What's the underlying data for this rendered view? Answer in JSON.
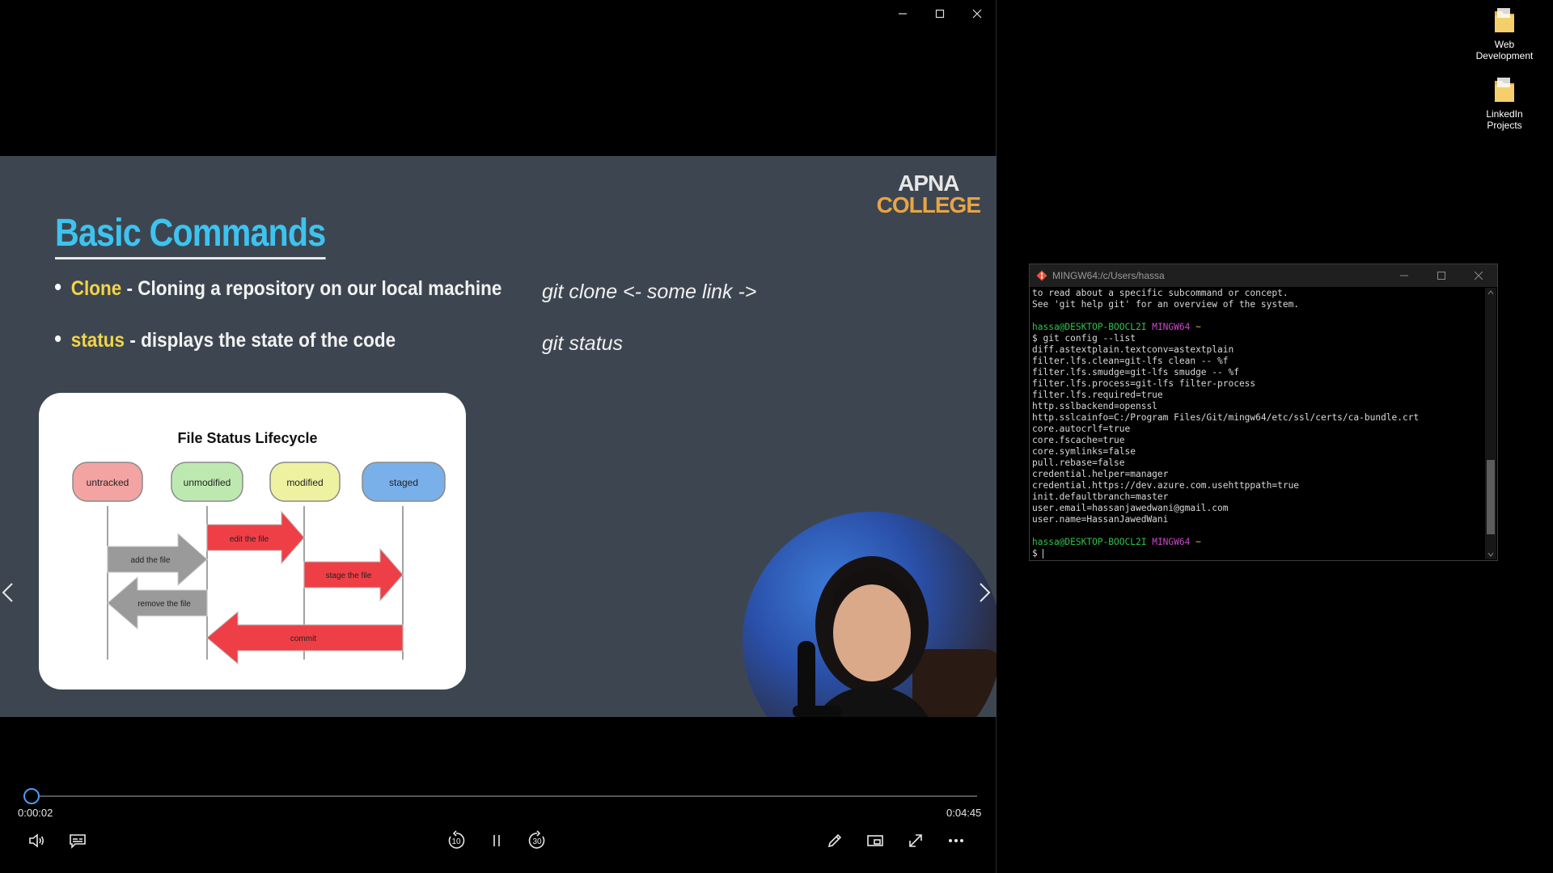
{
  "player": {
    "slide": {
      "logo_line1": "APNA",
      "logo_line2": "COLLEGE",
      "title": "Basic Commands",
      "bullets": [
        {
          "keyword": "Clone",
          "text": " - Cloning a repository on our local machine",
          "command": "git clone <- some link ->"
        },
        {
          "keyword": "status",
          "text": " - displays the state of the code",
          "command": "git status"
        }
      ],
      "diagram": {
        "title": "File Status Lifecycle",
        "states": [
          "untracked",
          "unmodified",
          "modified",
          "staged"
        ],
        "arrows": [
          "edit the file",
          "add the file",
          "stage the file",
          "remove the file",
          "commit"
        ],
        "colors": {
          "untracked": "#f4a3a3",
          "unmodified": "#bde9b0",
          "modified": "#eef2a0",
          "staged": "#79b0ea",
          "red_arrow": "#ef3f46",
          "gray_arrow": "#9a9a9a"
        }
      }
    },
    "controls": {
      "current_time": "0:00:02",
      "total_time": "0:04:45",
      "progress": 0.007,
      "skip_back_seconds": "10",
      "skip_forward_seconds": "30"
    },
    "accent_color": "#4a9cf5"
  },
  "desktop": {
    "icons": [
      {
        "label_line1": "Web",
        "label_line2": "Development"
      },
      {
        "label_line1": "LinkedIn",
        "label_line2": "Projects"
      }
    ]
  },
  "terminal": {
    "title": "MINGW64:/c/Users/hassa",
    "lines_top": [
      "to read about a specific subcommand or concept.",
      "See 'git help git' for an overview of the system.",
      ""
    ],
    "prompt1": {
      "user": "hassa@DESKTOP-BOOCL2I",
      "env": "MINGW64",
      "path": "~"
    },
    "command": "$ git config --list",
    "output": [
      "diff.astextplain.textconv=astextplain",
      "filter.lfs.clean=git-lfs clean -- %f",
      "filter.lfs.smudge=git-lfs smudge -- %f",
      "filter.lfs.process=git-lfs filter-process",
      "filter.lfs.required=true",
      "http.sslbackend=openssl",
      "http.sslcainfo=C:/Program Files/Git/mingw64/etc/ssl/certs/ca-bundle.crt",
      "core.autocrlf=true",
      "core.fscache=true",
      "core.symlinks=false",
      "pull.rebase=false",
      "credential.helper=manager",
      "credential.https://dev.azure.com.usehttppath=true",
      "init.defaultbranch=master",
      "user.email=hassanjawedwani@gmail.com",
      "user.name=HassanJawedWani"
    ],
    "prompt2": {
      "user": "hassa@DESKTOP-BOOCL2I",
      "env": "MINGW64",
      "path": "~"
    },
    "last_prompt": "$ "
  }
}
